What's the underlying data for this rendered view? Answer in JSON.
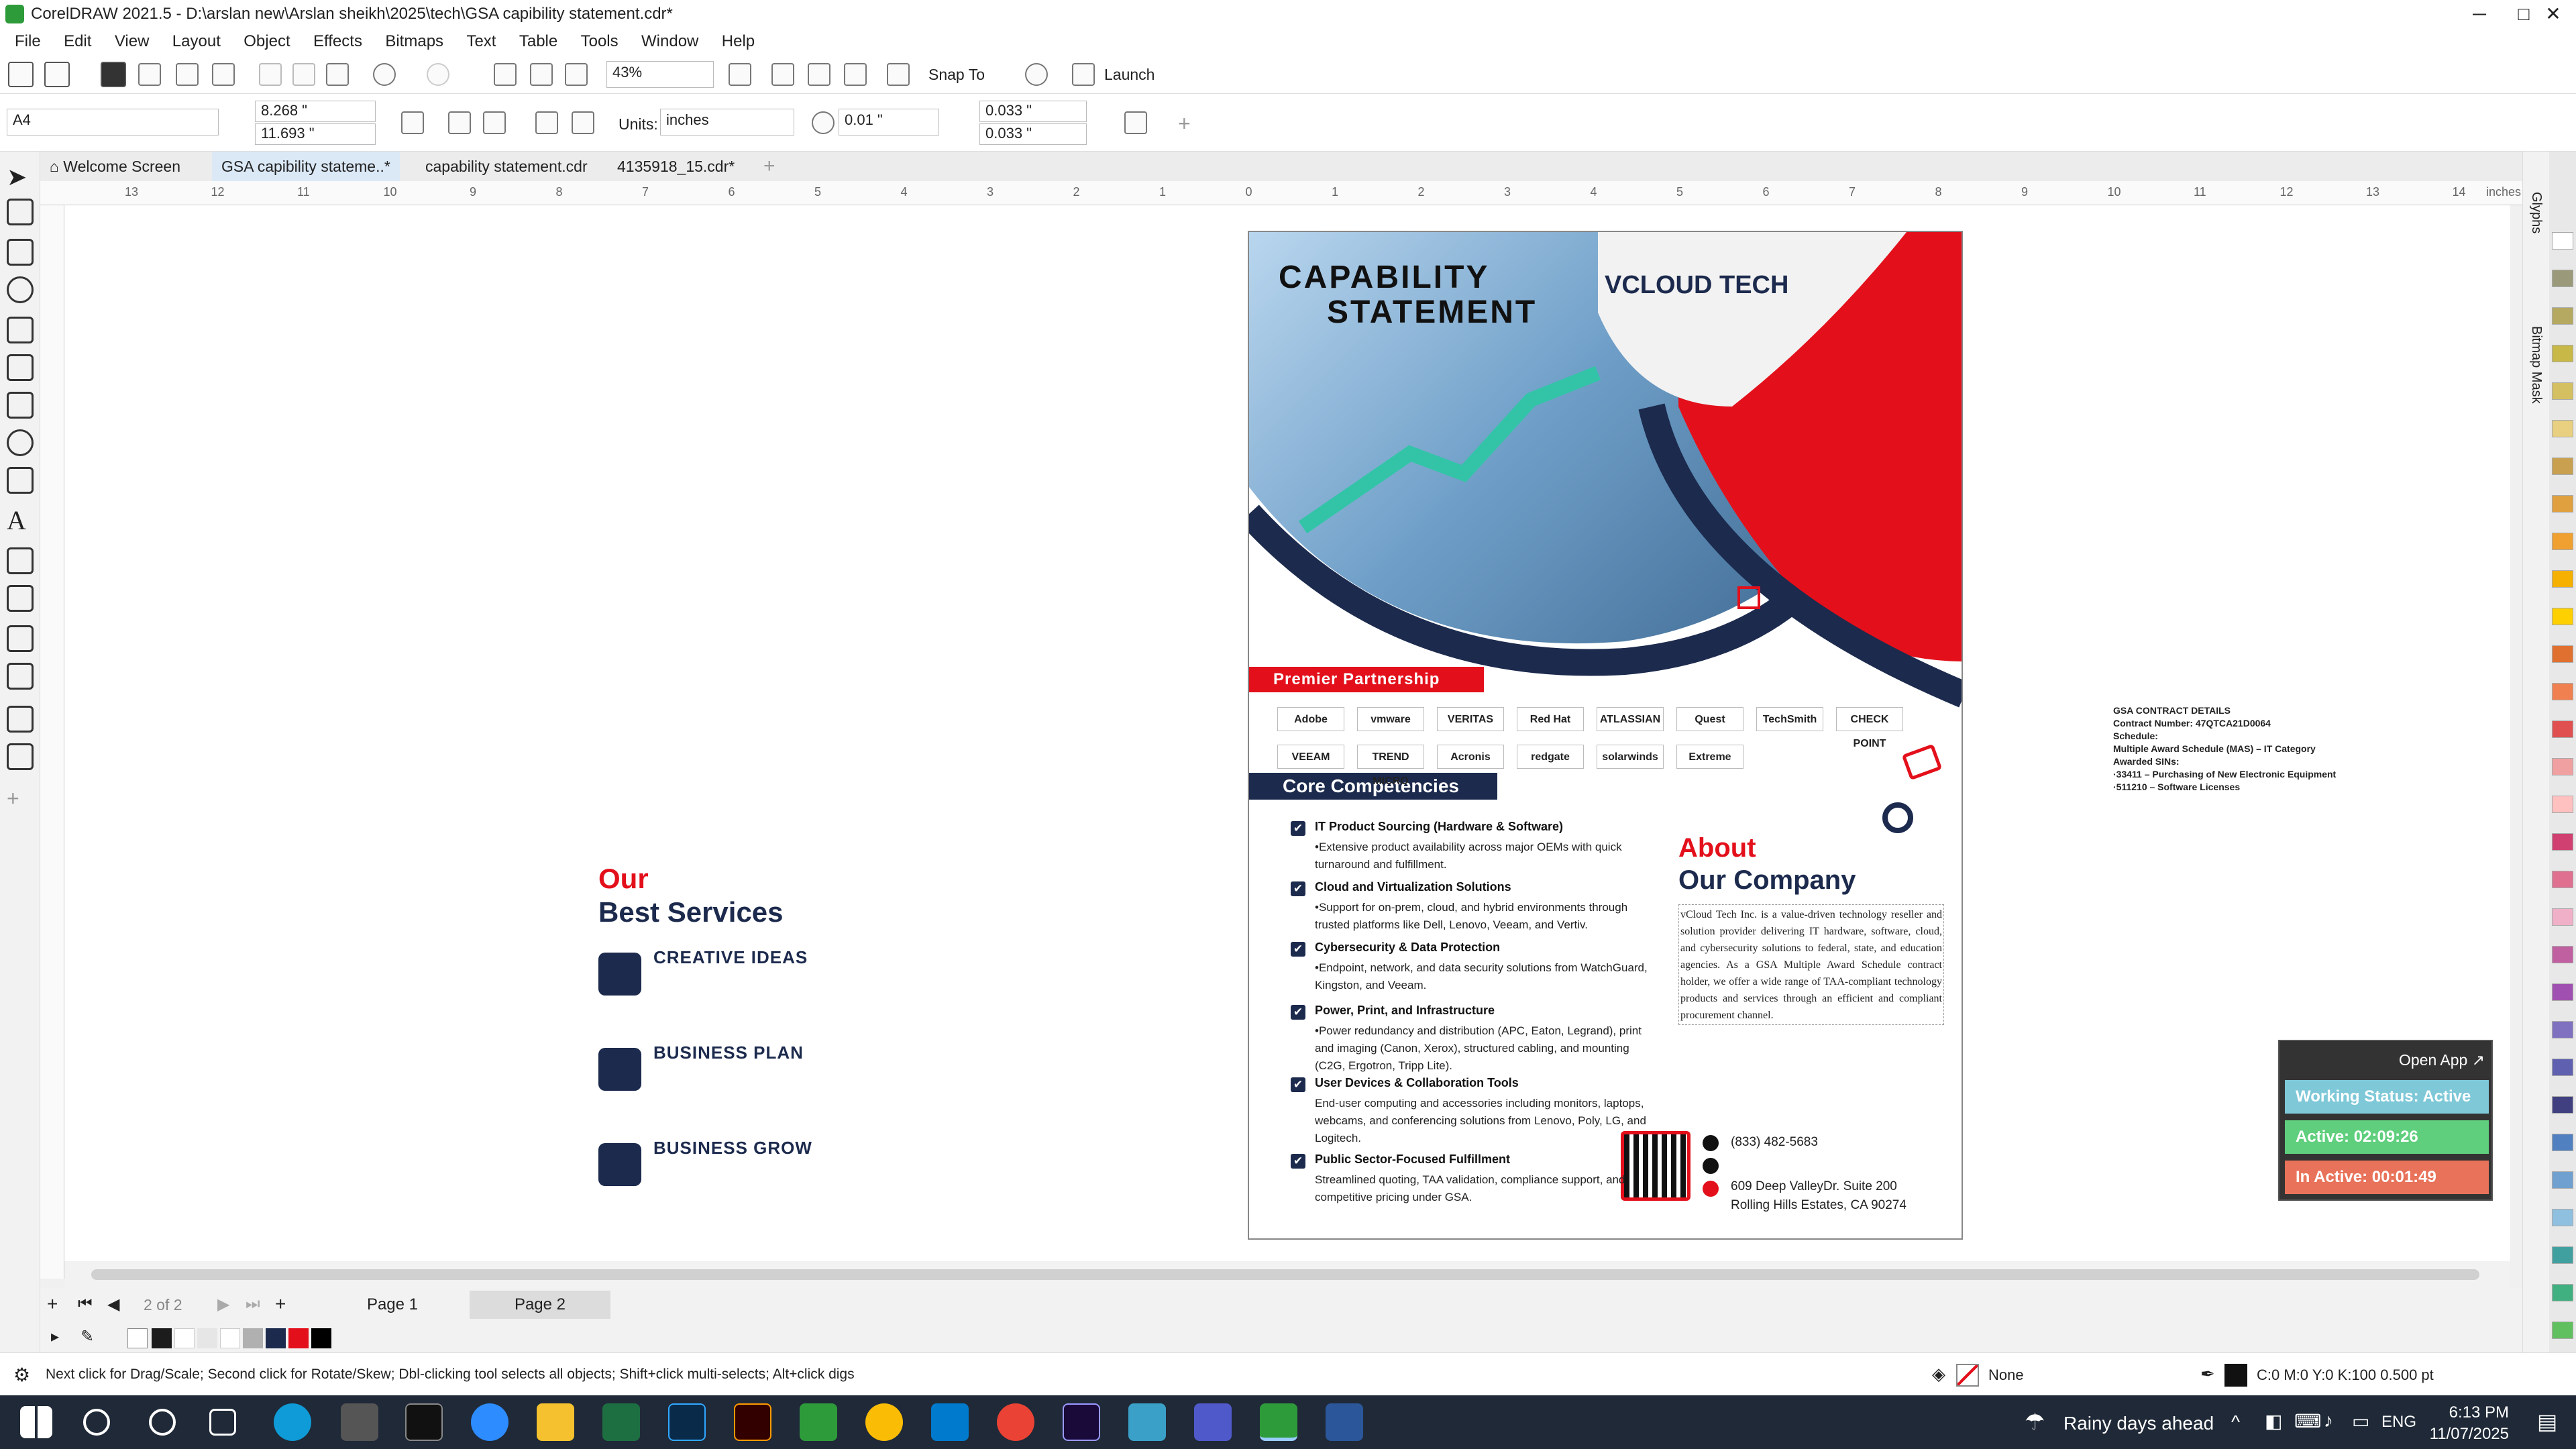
{
  "window": {
    "title": "CorelDRAW 2021.5 - D:\\arslan new\\Arslan sheikh\\2025\\tech\\GSA   capibility statement.cdr*",
    "min": "─",
    "max": "□",
    "close": "✕"
  },
  "menu": [
    "File",
    "Edit",
    "View",
    "Layout",
    "Object",
    "Effects",
    "Bitmaps",
    "Text",
    "Table",
    "Tools",
    "Window",
    "Help"
  ],
  "toolbar": {
    "zoom": "43%",
    "snap_to": "Snap To",
    "launch": "Launch"
  },
  "propbar": {
    "page_size": "A4",
    "width": "8.268 \"",
    "height": "11.693 \"",
    "units_label": "Units:",
    "units": "inches",
    "nudge": "0.01 \"",
    "dup_x": "0.033 \"",
    "dup_y": "0.033 \""
  },
  "tabs": [
    {
      "label": "Welcome Screen",
      "active": false
    },
    {
      "label": "GSA  capibility stateme..*",
      "active": true
    },
    {
      "label": "capability statement.cdr",
      "active": false
    },
    {
      "label": "4135918_15.cdr*",
      "active": false
    }
  ],
  "ruler": {
    "ticks": [
      "13",
      "12",
      "11",
      "10",
      "9",
      "8",
      "7",
      "6",
      "5",
      "4",
      "3",
      "2",
      "1",
      "0",
      "1",
      "2",
      "3",
      "4",
      "5",
      "6",
      "7",
      "8",
      "9",
      "10",
      "11",
      "12",
      "13",
      "14"
    ],
    "unit": "inches"
  },
  "dockers": [
    "Glyphs",
    "Bitmap Mask"
  ],
  "services": {
    "title1": "Our",
    "title2": "Best Services",
    "items": [
      "CREATIVE IDEAS",
      "BUSINESS PLAN",
      "BUSINESS GROW"
    ]
  },
  "poster": {
    "heading1": "CAPABILITY",
    "heading2": "STATEMENT",
    "logo": "VCLOUD TECH",
    "partnership": "Premier Partnership",
    "partners_row1": [
      "Adobe",
      "vmware",
      "VERITAS",
      "Red Hat",
      "ATLASSIAN",
      "Quest",
      "TechSmith",
      "CHECK POINT"
    ],
    "partners_row2": [
      "VEEAM",
      "TREND MICRO",
      "Acronis",
      "redgate",
      "solarwinds",
      "Extreme"
    ],
    "core_title": "Core Competencies",
    "competencies": [
      {
        "title": "IT Product Sourcing (Hardware & Software)",
        "desc": "•Extensive product availability across major OEMs with quick turnaround and fulfillment."
      },
      {
        "title": "Cloud and Virtualization Solutions",
        "desc": "•Support for on-prem, cloud, and hybrid environments through trusted platforms like Dell, Lenovo, Veeam, and Vertiv."
      },
      {
        "title": "Cybersecurity & Data Protection",
        "desc": "•Endpoint, network, and data security solutions from WatchGuard, Kingston, and Veeam."
      },
      {
        "title": "Power, Print, and Infrastructure",
        "desc": "•Power redundancy and distribution (APC, Eaton, Legrand), print and imaging (Canon, Xerox), structured cabling, and mounting (C2G, Ergotron, Tripp Lite)."
      },
      {
        "title": "User Devices & Collaboration Tools",
        "desc": "End-user computing and accessories including monitors, laptops, webcams, and conferencing solutions from Lenovo, Poly, LG, and Logitech."
      },
      {
        "title": "Public Sector-Focused Fulfillment",
        "desc": "Streamlined quoting, TAA validation, compliance support, and competitive pricing under GSA."
      }
    ],
    "about1": "About",
    "about2": "Our Company",
    "about_text": "vCloud Tech Inc. is a value-driven technology reseller and solution provider delivering IT hardware, software, cloud, and cybersecurity solutions to federal, state, and education agencies. As a GSA Multiple Award Schedule contract holder, we offer a wide range of TAA-compliant technology products and services through an efficient and compliant procurement channel.",
    "phone": "(833) 482-5683",
    "address1": "609 Deep ValleyDr. Suite 200",
    "address2": "Rolling Hills Estates, CA 90274"
  },
  "gsa": {
    "lines": [
      "GSA CONTRACT DETAILS",
      "Contract Number: 47QTCA21D0064",
      "Schedule:",
      "Multiple Award Schedule (MAS) – IT Category",
      "Awarded SINs:",
      "·33411 – Purchasing of New Electronic Equipment",
      "·511210 – Software Licenses"
    ]
  },
  "tracker": {
    "open_app": "Open App ↗",
    "status": "Working Status: Active",
    "active": "Active: 02:09:26",
    "inactive": "In Active: 00:01:49",
    "colors": {
      "status": "#7ec8d8",
      "active": "#5fcf7d",
      "inactive": "#e8735a"
    }
  },
  "pagenav": {
    "counter": "2 of 2",
    "pages": [
      "Page 1",
      "Page 2"
    ]
  },
  "statusbar": {
    "hint": "Next click for Drag/Scale; Second click for Rotate/Skew; Dbl-clicking tool selects all objects; Shift+click multi-selects; Alt+click digs",
    "fill": "None",
    "outline": "C:0 M:0 Y:0 K:100  0.500 pt"
  },
  "taskbar": {
    "weather": "Rainy days ahead",
    "lang": "ENG",
    "time": "6:13 PM",
    "date": "11/07/2025"
  },
  "colors": {
    "navy": "#1c2a4d",
    "red": "#e3101b",
    "accent": "#e3101b"
  }
}
